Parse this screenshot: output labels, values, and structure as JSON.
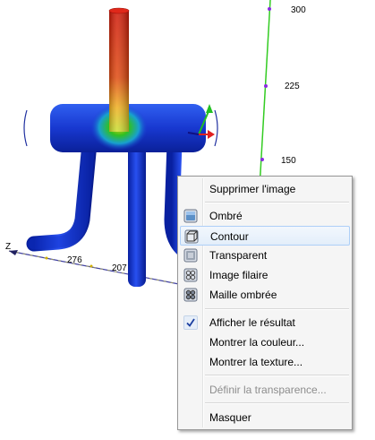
{
  "axis_labels": {
    "y_ticks": [
      "300",
      "225",
      "150"
    ],
    "z_axis_letter": "Z",
    "z_ticks": [
      "276",
      "207"
    ]
  },
  "colors": {
    "part_blue": "#1030c8",
    "hot_red": "#d81e0a",
    "axis_green": "#33cc22",
    "menu_highlight_border": "#aecff7",
    "check_blue": "#1a3ea0"
  },
  "context_menu": {
    "items": [
      {
        "label": "Supprimer l'image",
        "icon": "",
        "enabled": true
      },
      {
        "label": "Ombré",
        "icon": "shaded-cube-icon",
        "enabled": true
      },
      {
        "label": "Contour",
        "icon": "outline-cube-icon",
        "enabled": true,
        "highlighted": true
      },
      {
        "label": "Transparent",
        "icon": "transparent-cube-icon",
        "enabled": true
      },
      {
        "label": "Image filaire",
        "icon": "wireframe-mesh-icon",
        "enabled": true
      },
      {
        "label": "Maille ombrée",
        "icon": "shaded-mesh-icon",
        "enabled": true
      },
      {
        "label": "Afficher le résultat",
        "icon": "checkmark-icon",
        "enabled": true,
        "checked": true
      },
      {
        "label": "Montrer la couleur...",
        "icon": "",
        "enabled": true
      },
      {
        "label": "Montrer la texture...",
        "icon": "",
        "enabled": true
      },
      {
        "label": "Définir la transparence...",
        "icon": "",
        "enabled": false
      },
      {
        "label": "Masquer",
        "icon": "",
        "enabled": true
      }
    ]
  }
}
